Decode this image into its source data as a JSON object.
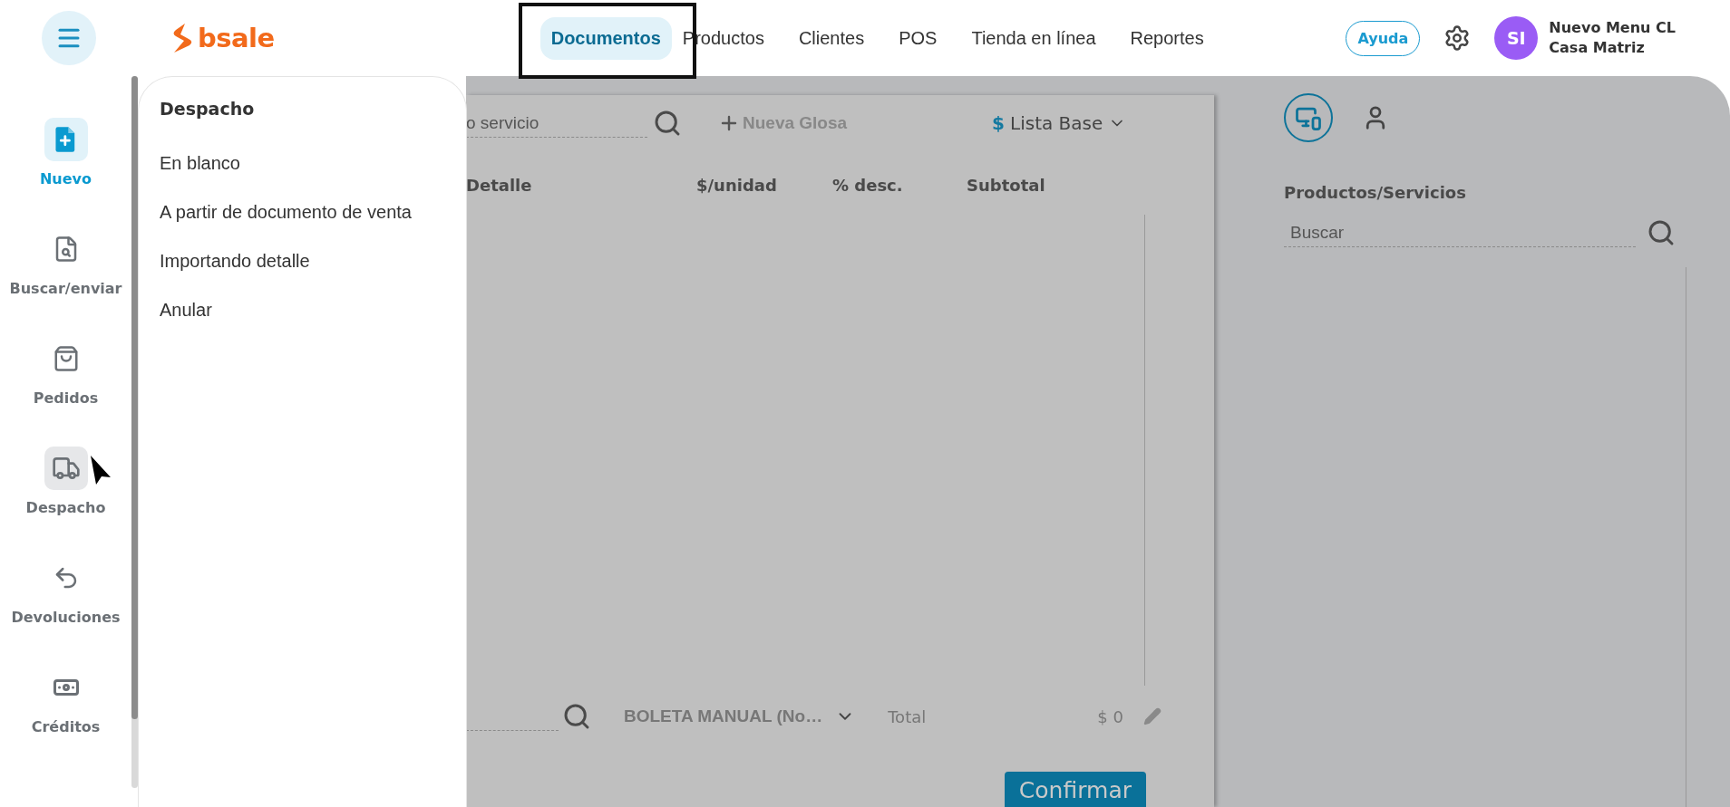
{
  "header": {
    "brand": "bsale",
    "nav": [
      {
        "label": "Documentos",
        "selected": true
      },
      {
        "label": "Productos",
        "selected": false
      },
      {
        "label": "Clientes",
        "selected": false
      },
      {
        "label": "POS",
        "selected": false
      },
      {
        "label": "Tienda en línea",
        "selected": false
      },
      {
        "label": "Reportes",
        "selected": false
      }
    ],
    "help_button": "Ayuda",
    "avatar": "SI",
    "user_name": "Nuevo Menu CL",
    "branch": "Casa Matriz"
  },
  "sidebar": {
    "items": [
      {
        "label": "Nuevo",
        "selected": true,
        "hovered": false
      },
      {
        "label": "Buscar/enviar",
        "selected": false,
        "hovered": false
      },
      {
        "label": "Pedidos",
        "selected": false,
        "hovered": false
      },
      {
        "label": "Despacho",
        "selected": false,
        "hovered": true
      },
      {
        "label": "Devoluciones",
        "selected": false,
        "hovered": false
      },
      {
        "label": "Créditos",
        "selected": false,
        "hovered": false
      }
    ]
  },
  "flyout": {
    "title": "Despacho",
    "items": [
      "En blanco",
      "A partir de documento de venta",
      "Importando detalle",
      "Anular"
    ]
  },
  "document": {
    "search": {
      "placeholder": "o servicio"
    },
    "new_line_button": "Nueva Glosa",
    "price_list": {
      "currency": "$",
      "label": "Lista Base"
    },
    "columns": [
      "Detalle",
      "$/unidad",
      "% desc.",
      "Subtotal"
    ],
    "document_type": "BOLETA MANUAL (No…",
    "total_label": "Total",
    "total_value": "$ 0",
    "confirm_button": "Confirmar"
  },
  "products_panel": {
    "tabs": [
      {
        "selected": true
      },
      {
        "selected": false
      }
    ],
    "title": "Productos/Servicios",
    "search": {
      "placeholder": "Buscar"
    }
  }
}
